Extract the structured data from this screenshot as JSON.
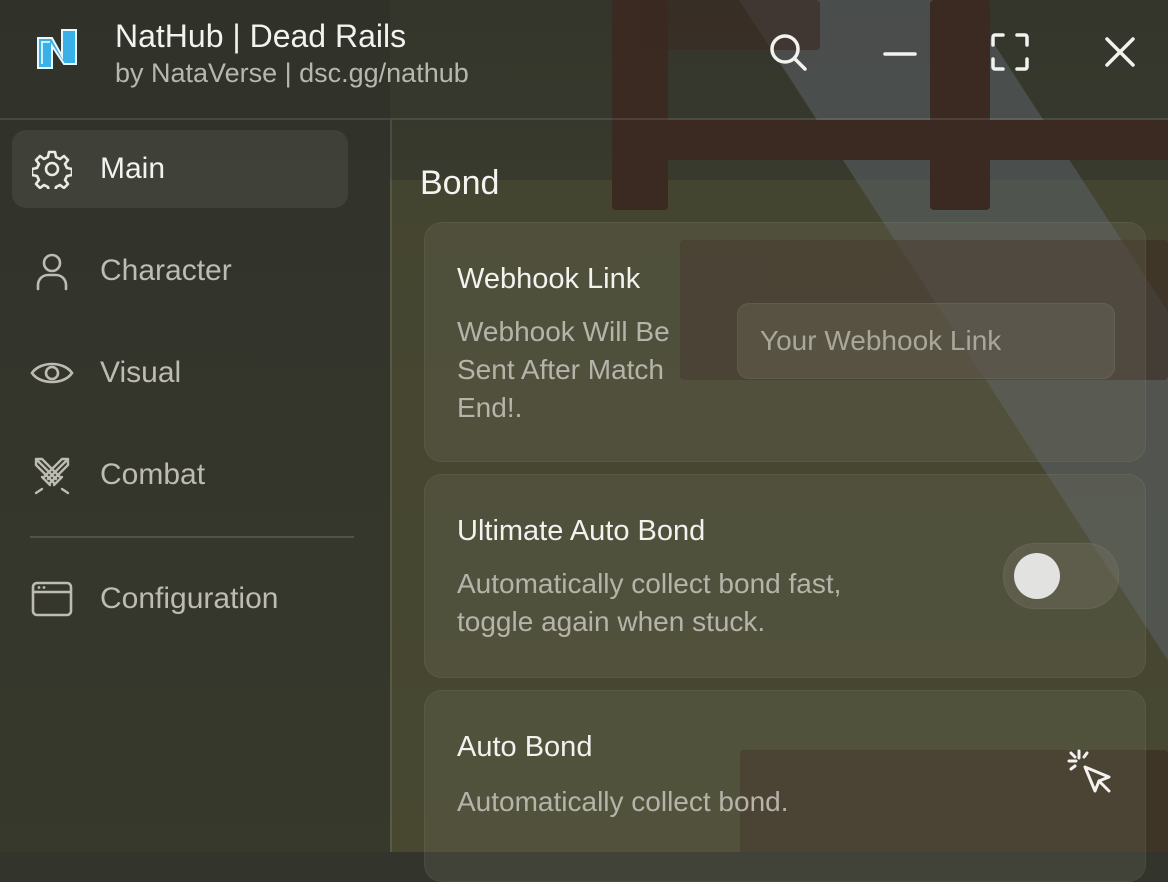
{
  "window": {
    "title": "NatHub | Dead Rails",
    "subtitle": "by NataVerse | dsc.gg/nathub",
    "logo_icon": "nathub-logo",
    "controls": [
      {
        "icon": "search-icon"
      },
      {
        "icon": "minimize-icon"
      },
      {
        "icon": "maximize-icon"
      },
      {
        "icon": "close-icon"
      }
    ]
  },
  "sidebar": {
    "items": [
      {
        "label": "Main",
        "icon": "gear-icon",
        "active": true
      },
      {
        "label": "Character",
        "icon": "user-icon",
        "active": false
      },
      {
        "label": "Visual",
        "icon": "eye-icon",
        "active": false
      },
      {
        "label": "Combat",
        "icon": "crossed-swords-icon",
        "active": false
      },
      {
        "label": "Configuration",
        "icon": "window-icon",
        "active": false
      }
    ]
  },
  "main": {
    "section_title": "Bond",
    "cards": [
      {
        "title": "Webhook Link",
        "description_lines": [
          "Webhook Will Be",
          "Sent After Match",
          "End!."
        ],
        "input_value": "",
        "input_placeholder": "Your Webhook Link"
      },
      {
        "title": "Ultimate Auto Bond",
        "description_lines": [
          "Automatically collect bond fast,",
          "toggle again when stuck."
        ],
        "toggle_on": false
      },
      {
        "title": "Auto Bond",
        "description_lines": [
          "Automatically collect bond."
        ],
        "action_icon": "click-icon"
      }
    ]
  },
  "colors": {
    "background": "#33352c",
    "text_primary": "#f2f2ee",
    "text_secondary": "#b6b4aa",
    "logo_accent": "#3ab0e8"
  }
}
